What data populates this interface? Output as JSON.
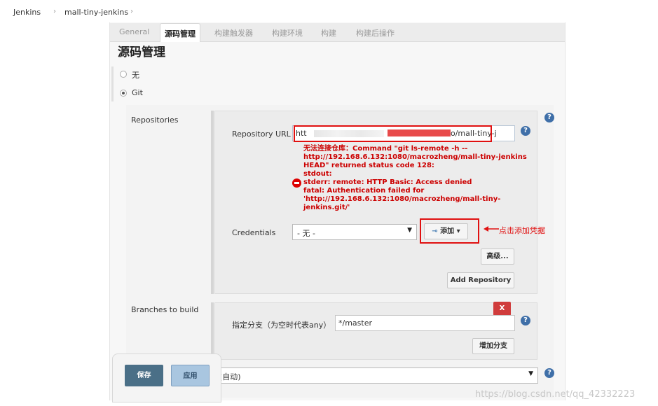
{
  "breadcrumb": {
    "root": "Jenkins",
    "job": "mall-tiny-jenkins",
    "sep": "›"
  },
  "tabs": [
    {
      "label": "General"
    },
    {
      "label": "源码管理"
    },
    {
      "label": "构建触发器"
    },
    {
      "label": "构建环境"
    },
    {
      "label": "构建"
    },
    {
      "label": "构建后操作"
    }
  ],
  "scm": {
    "title": "源码管理",
    "option_none": "无",
    "option_git": "Git",
    "selected": "Git"
  },
  "repositories": {
    "label": "Repositories",
    "url_label": "Repository URL",
    "url_value_visible_start": "htt",
    "url_value_visible_end": "o/mall-tiny-j",
    "error_lines": [
      "无法连接仓库：Command \"git ls-remote -h --",
      "http://192.168.6.132:1080/macrozheng/mall-tiny-jenkins",
      "HEAD\" returned status code 128:",
      "stdout:",
      "stderr: remote: HTTP Basic: Access denied",
      "fatal: Authentication failed for",
      "'http://192.168.6.132:1080/macrozheng/mall-tiny-",
      "jenkins.git/'"
    ],
    "credentials_label": "Credentials",
    "credentials_value": "- 无 -",
    "add_button": "添加",
    "annotation": "点击添加凭据",
    "advanced_button": "高级...",
    "add_repository_button": "Add Repository"
  },
  "branches": {
    "label": "Branches to build",
    "specifier_label": "指定分支（为空时代表any）",
    "specifier_value": "*/master",
    "delete_button": "X",
    "add_branch_button": "增加分支"
  },
  "browser": {
    "value": "(自动)"
  },
  "actions": {
    "save": "保存",
    "apply": "应用"
  },
  "watermark": "https://blog.csdn.net/qq_42332223",
  "colors": {
    "error": "#cc0000",
    "annotation": "#e01010",
    "help": "#3f6fa8",
    "save": "#4a6f87",
    "apply": "#a9c6e0"
  }
}
